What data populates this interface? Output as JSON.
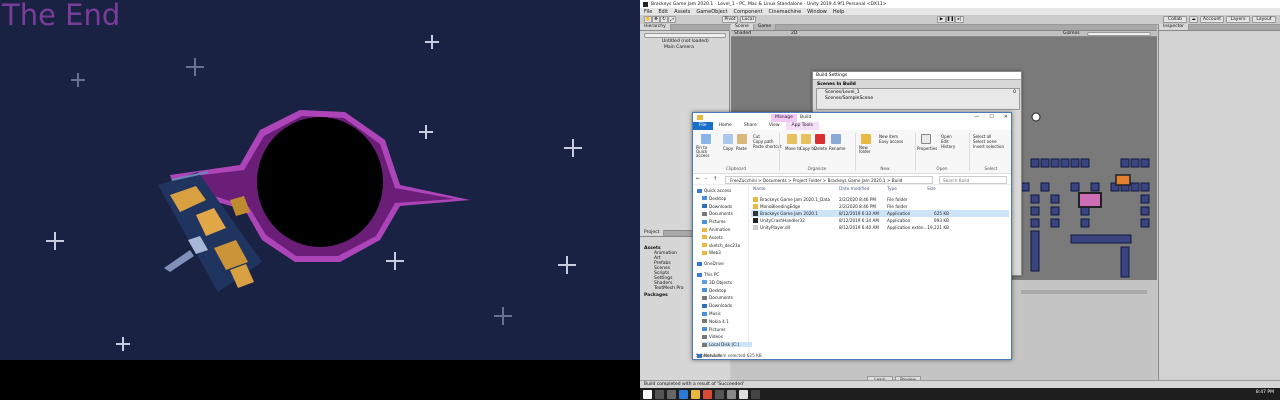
{
  "game": {
    "end_title": "The End"
  },
  "unity": {
    "title": "Brackeys Game Jam 2020.1 - Level_1 - PC, Mac & Linux Standalone - Unity 2019.4.9f1 Personal <DX11>",
    "menu": [
      "File",
      "Edit",
      "Assets",
      "GameObject",
      "Component",
      "Cinemachine",
      "Window",
      "Help"
    ],
    "toolbar": {
      "pivot": "Pivot",
      "local": "Local",
      "collab": "Collab",
      "account": "Account",
      "layers": "Layers",
      "layout": "Layout"
    },
    "hierarchy": {
      "tab": "Hierarchy",
      "search_placeholder": "All",
      "items": [
        "Untitled (not loaded)",
        "Main Camera"
      ]
    },
    "scene": {
      "tabs": [
        "Scene",
        "Game"
      ],
      "shading": "Shaded",
      "gizmos": "Gizmos",
      "search_placeholder": "All"
    },
    "inspector": {
      "tab": "Inspector"
    },
    "project": {
      "tab": "Project",
      "folders_header": "Assets",
      "folders": [
        "Animation",
        "Art",
        "Prefabs",
        "Scenes",
        "Scripts",
        "Settings",
        "Shaders",
        "TextMesh Pro"
      ],
      "packages": "Packages"
    },
    "console_buttons": [
      "Learn",
      "Preview"
    ],
    "status": "Build completed with a result of 'Succeeded'",
    "taskbar_time": "8:47 PM"
  },
  "build_settings": {
    "title": "Build Settings",
    "header": "Scenes In Build",
    "scenes": [
      "Scenes/Level_1",
      "Scenes/SampleScene"
    ],
    "scene_index": "0"
  },
  "explorer": {
    "tabs": {
      "manage": "Manage",
      "build": "Build"
    },
    "ribbon_tabs": [
      "File",
      "Home",
      "Share",
      "View",
      "App Tools"
    ],
    "ribbon": {
      "pin": "Pin to Quick access",
      "copy": "Copy",
      "paste": "Paste",
      "cut": "Cut",
      "copy_path": "Copy path",
      "paste_shortcut": "Paste shortcut",
      "move_to": "Move to",
      "copy_to": "Copy to",
      "delete": "Delete",
      "rename": "Rename",
      "new_folder": "New folder",
      "new_item": "New item",
      "easy_access": "Easy access",
      "properties": "Properties",
      "open": "Open",
      "edit": "Edit",
      "history": "History",
      "select_all": "Select all",
      "select_none": "Select none",
      "invert": "Invert selection",
      "groups": [
        "Clipboard",
        "Organize",
        "New",
        "Open",
        "Select"
      ]
    },
    "address": "FreeZucchini > Documents > Project Folder > Brackeys Game Jam 2020.1 > Build",
    "search_placeholder": "Search Build",
    "nav": [
      {
        "label": "Quick access",
        "color": "#3a7bd5"
      },
      {
        "label": "Desktop",
        "color": "#4a90e2"
      },
      {
        "label": "Downloads",
        "color": "#2e6fbf"
      },
      {
        "label": "Documents",
        "color": "#777777"
      },
      {
        "label": "Pictures",
        "color": "#4a90e2"
      },
      {
        "label": "Animation",
        "color": "#e8b840"
      },
      {
        "label": "Assets",
        "color": "#e8b840"
      },
      {
        "label": "sketch_dec23a",
        "color": "#e8b840"
      },
      {
        "label": "Web3",
        "color": "#e8b840"
      },
      {
        "label": "OneDrive",
        "color": "#2a7ad6"
      },
      {
        "label": "This PC",
        "color": "#3a7bd5"
      },
      {
        "label": "3D Objects",
        "color": "#5aa0e0"
      },
      {
        "label": "Desktop",
        "color": "#4a90e2"
      },
      {
        "label": "Documents",
        "color": "#777777"
      },
      {
        "label": "Downloads",
        "color": "#2e6fbf"
      },
      {
        "label": "Music",
        "color": "#4a90e2"
      },
      {
        "label": "Nokia 4.1",
        "color": "#777777"
      },
      {
        "label": "Pictures",
        "color": "#4a90e2"
      },
      {
        "label": "Videos",
        "color": "#777777"
      },
      {
        "label": "Local Disk (C:)",
        "color": "#777777"
      },
      {
        "label": "Network",
        "color": "#3a7bd5"
      }
    ],
    "columns": [
      "Name",
      "Date modified",
      "Type",
      "Size"
    ],
    "files": [
      {
        "name": "Brackeys Game Jam 2020.1_Data",
        "date": "2/2/2020 8:46 PM",
        "type": "File folder",
        "size": "",
        "icon": "#e8b840"
      },
      {
        "name": "MonoBleedingEdge",
        "date": "2/2/2020 8:46 PM",
        "type": "File folder",
        "size": "",
        "icon": "#e8b840"
      },
      {
        "name": "Brackeys Game Jam 2020.1",
        "date": "8/12/2019 6:33 AM",
        "type": "Application",
        "size": "625 KB",
        "icon": "#333333"
      },
      {
        "name": "UnityCrashHandler32",
        "date": "8/12/2019 6:34 AM",
        "type": "Application",
        "size": "993 KB",
        "icon": "#222222"
      },
      {
        "name": "UnityPlayer.dll",
        "date": "8/12/2019 6:40 AM",
        "type": "Application exten...",
        "size": "19,221 KB",
        "icon": "#cccccc"
      }
    ],
    "status": "5 items    1 item selected  625 KB"
  }
}
